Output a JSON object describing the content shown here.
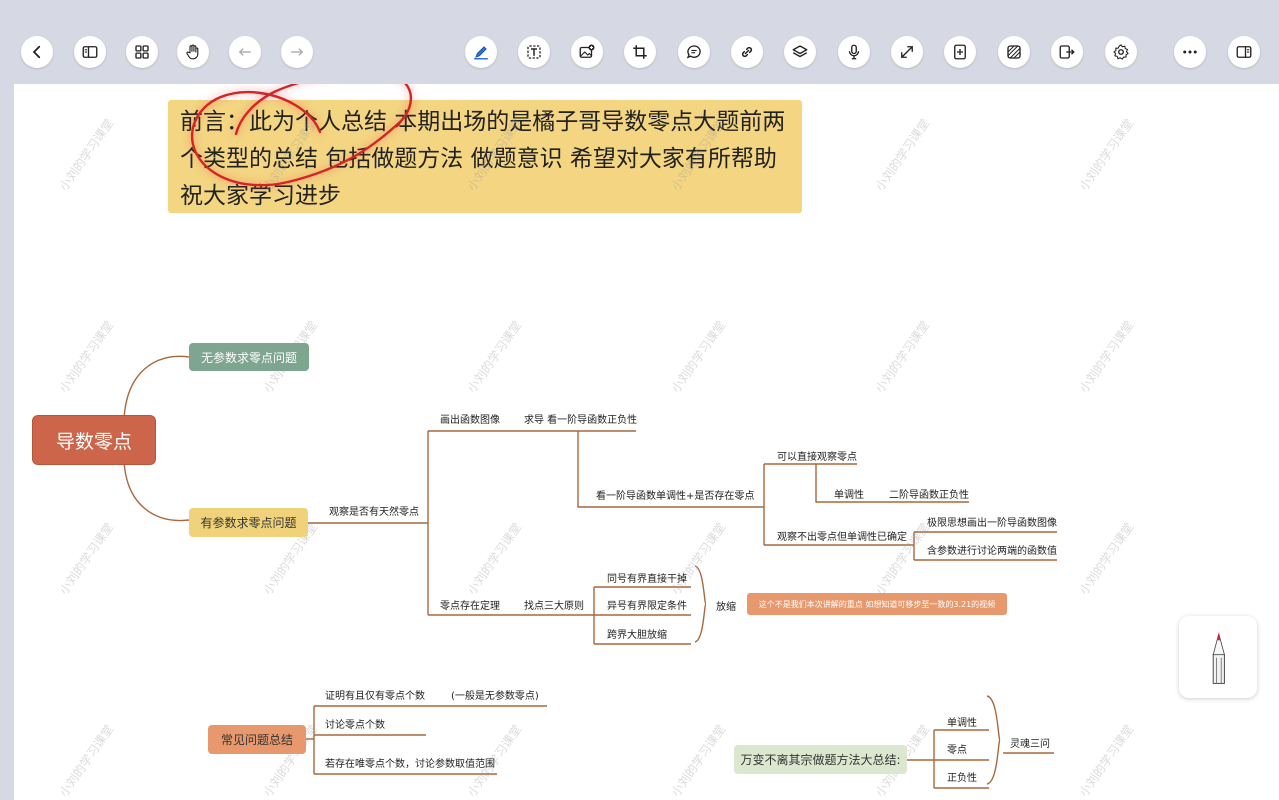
{
  "intro_text": "前言：此为个人总结 本期出场的是橘子哥导数零点大题前两个类型的总结 包括做题方法 做题意识 希望对大家有所帮助 祝大家学习进步",
  "toolbar_icons": [
    "back-icon",
    "sidebar-icon",
    "grid-icon",
    "hand-icon",
    "undo-icon",
    "redo-icon",
    "pen-icon",
    "text-icon",
    "image-add-icon",
    "crop-icon",
    "comment-icon",
    "link-icon",
    "layers-icon",
    "microphone-icon",
    "expand-icon",
    "add-page-icon",
    "shape-fill-icon",
    "export-icon",
    "settings-icon",
    "more-icon",
    "split-view-icon"
  ],
  "mindmap": {
    "root": "导数零点",
    "branch_no_param": "无参数求零点问题",
    "branch_param": "有参数求零点问题",
    "observe_natural_zero": "观察是否有天然零点",
    "draw_graph": "画出函数图像",
    "derive_check": "求导 看一阶导函数正负性",
    "check_mono": "看一阶导函数单调性+是否存在零点",
    "direct_observe": "可以直接观察零点",
    "monotonic": "单调性",
    "second_derivative": "二阶导函数正负性",
    "mono_determined": "观察不出零点但单调性已确定",
    "limit_idea": "极限思想画出一阶导函数图像",
    "param_discuss": "含参数进行讨论两端的函数值",
    "zero_theorem": "零点存在定理",
    "three_principles": "找点三大原则",
    "same_sign": "同号有界直接干掉",
    "diff_sign": "异号有界限定条件",
    "cross_bound": "跨界大胆放缩",
    "scale": "放缩",
    "scale_note": "这个不是我们本次讲解的重点 如想知道可移步至一数的3.21的视频"
  },
  "common": {
    "title": "常见问题总结",
    "item1": "证明有且仅有零点个数",
    "item1_note": "(一般是无参数零点)",
    "item2": "讨论零点个数",
    "item3": "若存在唯零点个数，讨论参数取值范围"
  },
  "summary": {
    "title": "万变不离其宗做题方法大总结:",
    "item1": "单调性",
    "item2": "零点",
    "item3": "正负性",
    "result": "灵魂三问"
  },
  "watermark": "小刘的学习课堂",
  "colors": {
    "root": "#cd654a",
    "no_param": "#7ea590",
    "param": "#f0d27a",
    "common": "#e7996d",
    "summary": "#dbe8cf",
    "line": "#a9683c"
  }
}
